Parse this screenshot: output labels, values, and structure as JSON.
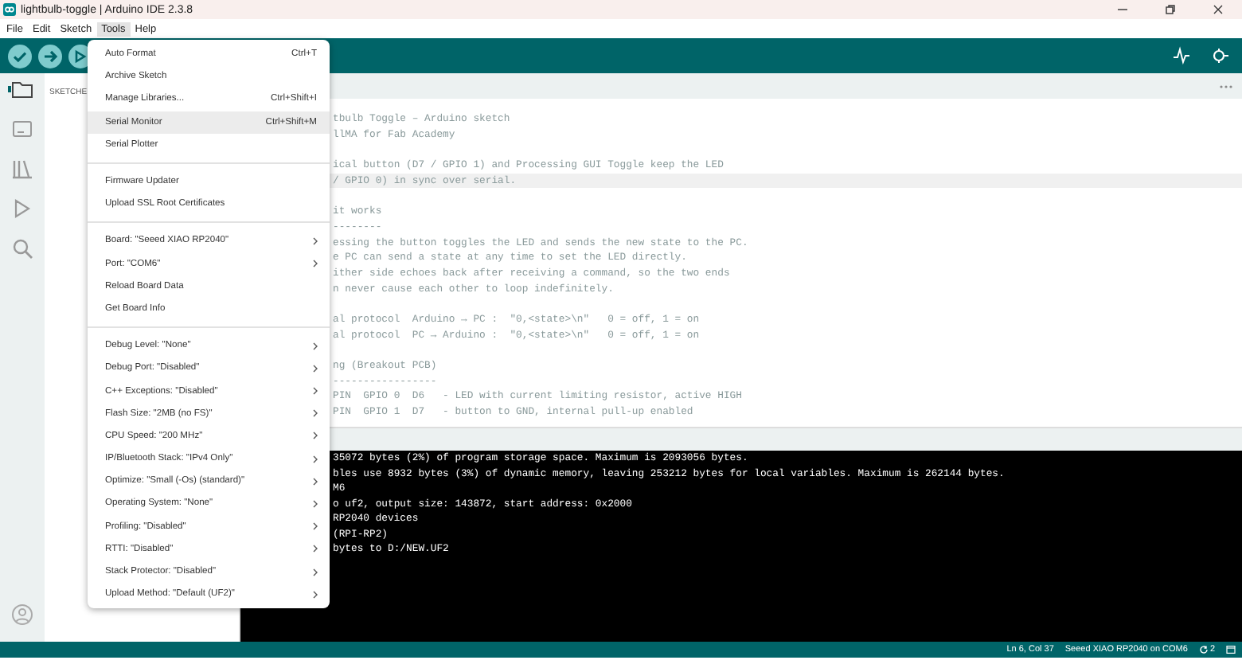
{
  "window": {
    "title": "lightbulb-toggle | Arduino IDE 2.3.8"
  },
  "menubar": [
    {
      "label": "File",
      "selected": false
    },
    {
      "label": "Edit",
      "selected": false
    },
    {
      "label": "Sketch",
      "selected": false
    },
    {
      "label": "Tools",
      "selected": true
    },
    {
      "label": "Help",
      "selected": false
    }
  ],
  "sidebar": {
    "title": "SKETCHE"
  },
  "editor": {
    "lines": [
      {
        "text": "tbulb Toggle – Arduino sketch",
        "current": false
      },
      {
        "text": "llMA for Fab Academy",
        "current": false
      },
      {
        "current": false
      },
      {
        "text": "ical button (D7 / GPIO 1) and Processing GUI Toggle keep the LED",
        "current": false
      },
      {
        "text": "/ GPIO 0) in sync over serial.",
        "current": true
      },
      {
        "current": false
      },
      {
        "text": "it works",
        "current": false
      },
      {
        "text": "--------",
        "current": false
      },
      {
        "text": "essing the button toggles the LED and sends the new state to the PC.",
        "current": false
      },
      {
        "text": "e PC can send a state at any time to set the LED directly.",
        "current": false
      },
      {
        "text": "ither side echoes back after receiving a command, so the two ends",
        "current": false
      },
      {
        "text": "n never cause each other to loop indefinitely.",
        "current": false
      },
      {
        "current": false
      },
      {
        "text": "al protocol  Arduino → PC :  \"0,<state>\\n\"   0 = off, 1 = on",
        "current": false
      },
      {
        "text": "al protocol  PC → Arduino :  \"0,<state>\\n\"   0 = off, 1 = on",
        "current": false
      },
      {
        "current": false
      },
      {
        "text": "ng (Breakout PCB)",
        "current": false
      },
      {
        "text": "-----------------",
        "current": false
      },
      {
        "text": "PIN  GPIO 0  D6   - LED with current limiting resistor, active HIGH",
        "current": false
      },
      {
        "text": "PIN  GPIO 1  D7   - button to GND, internal pull-up enabled",
        "current": false
      }
    ]
  },
  "output": {
    "lines": [
      "35072 bytes (2%) of program storage space. Maximum is 2093056 bytes.",
      "bles use 8932 bytes (3%) of dynamic memory, leaving 253212 bytes for local variables. Maximum is 262144 bytes.",
      "M6",
      "o uf2, output size: 143872, start address: 0x2000",
      "RP2040 devices",
      "(RPI-RP2)",
      "bytes to D:/NEW.UF2"
    ]
  },
  "tools_menu": {
    "groups": [
      [
        {
          "kind": "command",
          "label": "Auto Format",
          "shortcut": "Ctrl+T",
          "selected": false
        },
        {
          "kind": "command",
          "label": "Archive Sketch",
          "selected": false
        },
        {
          "kind": "command",
          "label": "Manage Libraries...",
          "shortcut": "Ctrl+Shift+I",
          "selected": false
        },
        {
          "kind": "command",
          "label": "Serial Monitor",
          "shortcut": "Ctrl+Shift+M",
          "selected": true
        },
        {
          "kind": "command",
          "label": "Serial Plotter",
          "selected": false
        }
      ],
      [
        {
          "kind": "command",
          "label": "Firmware Updater",
          "selected": false
        },
        {
          "kind": "command",
          "label": "Upload SSL Root Certificates",
          "selected": false
        }
      ],
      [
        {
          "kind": "submenu",
          "label": "Board: \"Seeed XIAO RP2040\"",
          "selected": false
        },
        {
          "kind": "submenu",
          "label": "Port: \"COM6\"",
          "selected": false
        },
        {
          "kind": "command",
          "label": "Reload Board Data",
          "selected": false
        },
        {
          "kind": "command",
          "label": "Get Board Info",
          "selected": false
        }
      ],
      [
        {
          "kind": "submenu",
          "label": "Debug Level: \"None\"",
          "selected": false
        },
        {
          "kind": "submenu",
          "label": "Debug Port: \"Disabled\"",
          "selected": false
        },
        {
          "kind": "submenu",
          "label": "C++ Exceptions: \"Disabled\"",
          "selected": false
        },
        {
          "kind": "submenu",
          "label": "Flash Size: \"2MB (no FS)\"",
          "selected": false
        },
        {
          "kind": "submenu",
          "label": "CPU Speed: \"200 MHz\"",
          "selected": false
        },
        {
          "kind": "submenu",
          "label": "IP/Bluetooth Stack: \"IPv4 Only\"",
          "selected": false
        },
        {
          "kind": "submenu",
          "label": "Optimize: \"Small (-Os) (standard)\"",
          "selected": false
        },
        {
          "kind": "submenu",
          "label": "Operating System: \"None\"",
          "selected": false
        },
        {
          "kind": "submenu",
          "label": "Profiling: \"Disabled\"",
          "selected": false
        },
        {
          "kind": "submenu",
          "label": "RTTI: \"Disabled\"",
          "selected": false
        },
        {
          "kind": "submenu",
          "label": "Stack Protector: \"Disabled\"",
          "selected": false
        },
        {
          "kind": "submenu",
          "label": "Upload Method: \"Default (UF2)\"",
          "selected": false
        }
      ]
    ]
  },
  "status_bar": {
    "position": "Ln 6, Col 37",
    "board": "Seeed XIAO RP2040 on COM6",
    "notifications": "2"
  }
}
